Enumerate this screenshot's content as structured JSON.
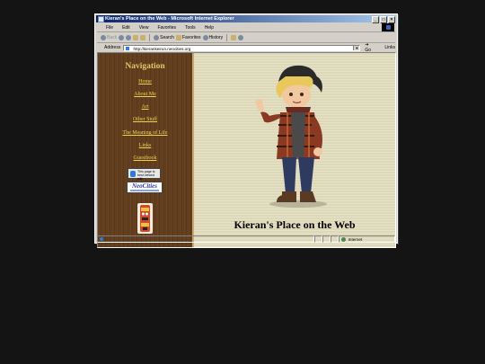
{
  "window": {
    "title": "Kieran's Place on the Web - Microsoft Internet Explorer"
  },
  "menu": [
    "File",
    "Edit",
    "View",
    "Favorites",
    "Tools",
    "Help"
  ],
  "toolbar": {
    "back": "Back",
    "search": "Search",
    "favorites": "Favorites",
    "history": "History"
  },
  "address": {
    "label": "Address",
    "url": "http://kierankeirun.neocities.org",
    "go": "Go",
    "links": "Links"
  },
  "nav": {
    "title": "Navigation",
    "links": [
      "Home",
      "About Me",
      "Art",
      "Other Stuff",
      "The Meaning of Life",
      "Links",
      "Guestbook"
    ],
    "badge1_text": "This page is best viewed with",
    "badge2_text": "NeoCities"
  },
  "main": {
    "heading": "Kieran's Place on the Web"
  },
  "status": {
    "zone": "Internet"
  }
}
